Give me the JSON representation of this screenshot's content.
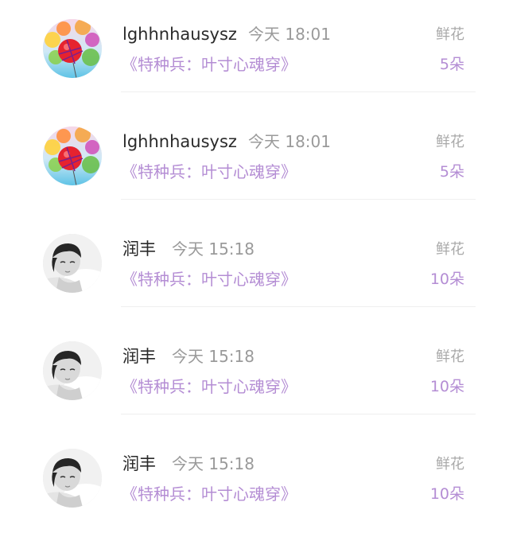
{
  "records": [
    {
      "avatar": "balloons-avatar",
      "name": "lghhnhausysz",
      "time": "今天 18:01",
      "book": "《特种兵：叶寸心魂穿》",
      "gift_label": "鲜花",
      "gift_count": "5朵"
    },
    {
      "avatar": "balloons-avatar",
      "name": "lghhnhausysz",
      "time": "今天 18:01",
      "book": "《特种兵：叶寸心魂穿》",
      "gift_label": "鲜花",
      "gift_count": "5朵"
    },
    {
      "avatar": "portrait-avatar",
      "name": "润丰",
      "time": "今天 15:18",
      "book": "《特种兵：叶寸心魂穿》",
      "gift_label": "鲜花",
      "gift_count": "10朵"
    },
    {
      "avatar": "portrait-avatar",
      "name": "润丰",
      "time": "今天 15:18",
      "book": "《特种兵：叶寸心魂穿》",
      "gift_label": "鲜花",
      "gift_count": "10朵"
    },
    {
      "avatar": "portrait-avatar",
      "name": "润丰",
      "time": "今天 15:18",
      "book": "《特种兵：叶寸心魂穿》",
      "gift_label": "鲜花",
      "gift_count": "10朵"
    }
  ],
  "colors": {
    "accent": "#b48dd4",
    "name": "#2a2a2a",
    "muted": "#9a9a9a",
    "divider": "#efefef"
  }
}
